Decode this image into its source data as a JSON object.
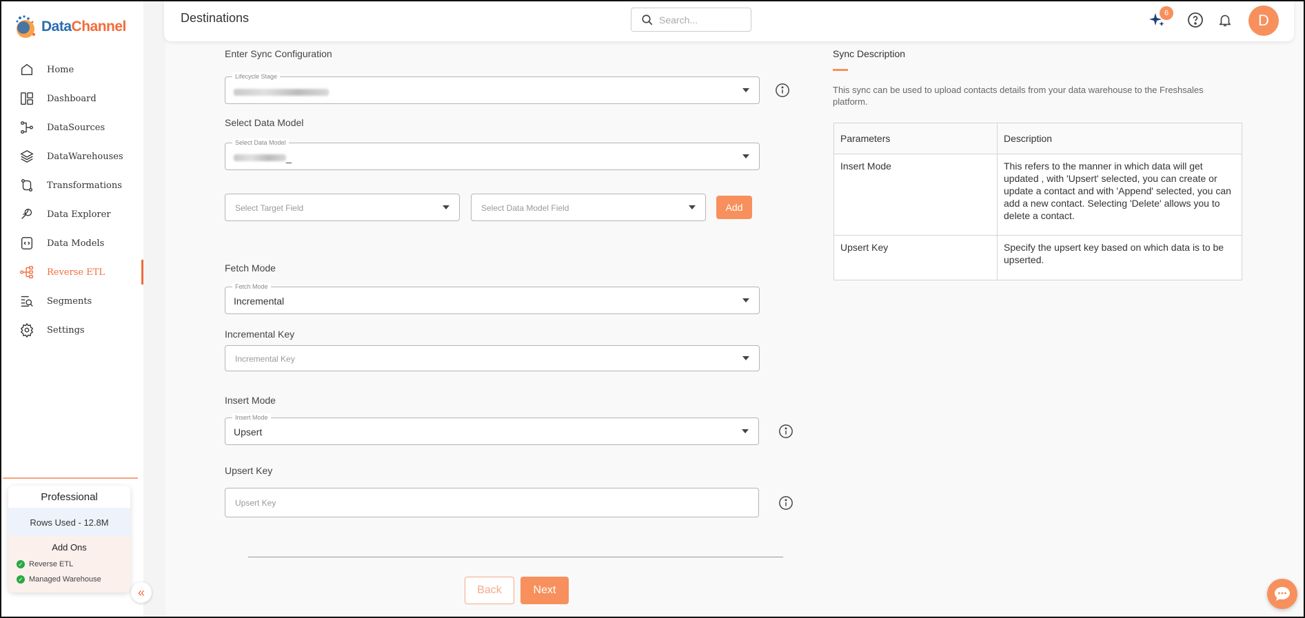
{
  "app": {
    "logo_part1": "Data",
    "logo_part2": "Channel",
    "brand_color": "#f7905c"
  },
  "sidebar": {
    "items": [
      {
        "label": "Home",
        "icon": "home-icon"
      },
      {
        "label": "Dashboard",
        "icon": "dashboard-icon"
      },
      {
        "label": "DataSources",
        "icon": "datasources-icon"
      },
      {
        "label": "DataWarehouses",
        "icon": "datawarehouses-icon"
      },
      {
        "label": "Transformations",
        "icon": "transformations-icon"
      },
      {
        "label": "Data Explorer",
        "icon": "data-explorer-icon"
      },
      {
        "label": "Data Models",
        "icon": "data-models-icon"
      },
      {
        "label": "Reverse ETL",
        "icon": "reverse-etl-icon",
        "active": true
      },
      {
        "label": "Segments",
        "icon": "segments-icon"
      },
      {
        "label": "Settings",
        "icon": "gear-icon"
      }
    ],
    "plan": {
      "title": "Professional",
      "rows_used": "Rows Used - 12.8M",
      "addons_title": "Add Ons",
      "addons": [
        "Reverse ETL",
        "Managed Warehouse"
      ]
    }
  },
  "header": {
    "title": "Destinations",
    "search_placeholder": "Search...",
    "notification_count": "6",
    "avatar_letter": "D"
  },
  "form": {
    "sync_config_label": "Enter Sync Configuration",
    "lifecycle_stage_label": "Lifecycle Stage",
    "select_data_model_heading": "Select Data Model",
    "select_data_model_label": "Select Data Model",
    "data_model_suffix": "_",
    "target_field_placeholder": "Select Target Field",
    "data_model_field_placeholder": "Select Data Model Field",
    "add_label": "Add",
    "fetch_mode_heading": "Fetch Mode",
    "fetch_mode_label": "Fetch Mode",
    "fetch_mode_value": "Incremental",
    "incremental_key_heading": "Incremental Key",
    "incremental_key_placeholder": "Incremental Key",
    "insert_mode_heading": "Insert Mode",
    "insert_mode_label": "Insert Mode",
    "insert_mode_value": "Upsert",
    "upsert_key_heading": "Upsert Key",
    "upsert_key_placeholder": "Upsert Key",
    "back_label": "Back",
    "next_label": "Next"
  },
  "sync_description": {
    "title": "Sync Description",
    "text": "This sync can be used to upload contacts details from your data warehouse to the Freshsales platform.",
    "table": {
      "headers": [
        "Parameters",
        "Description"
      ],
      "rows": [
        [
          "Insert Mode",
          "This refers to the manner in which data will get updated , with 'Upsert' selected, you can create or update a contact and with 'Append' selected, you can add a new contact. Selecting 'Delete' allows you to delete a contact."
        ],
        [
          "Upsert Key",
          "Specify the upsert key based on which data is to be upserted."
        ]
      ]
    }
  }
}
